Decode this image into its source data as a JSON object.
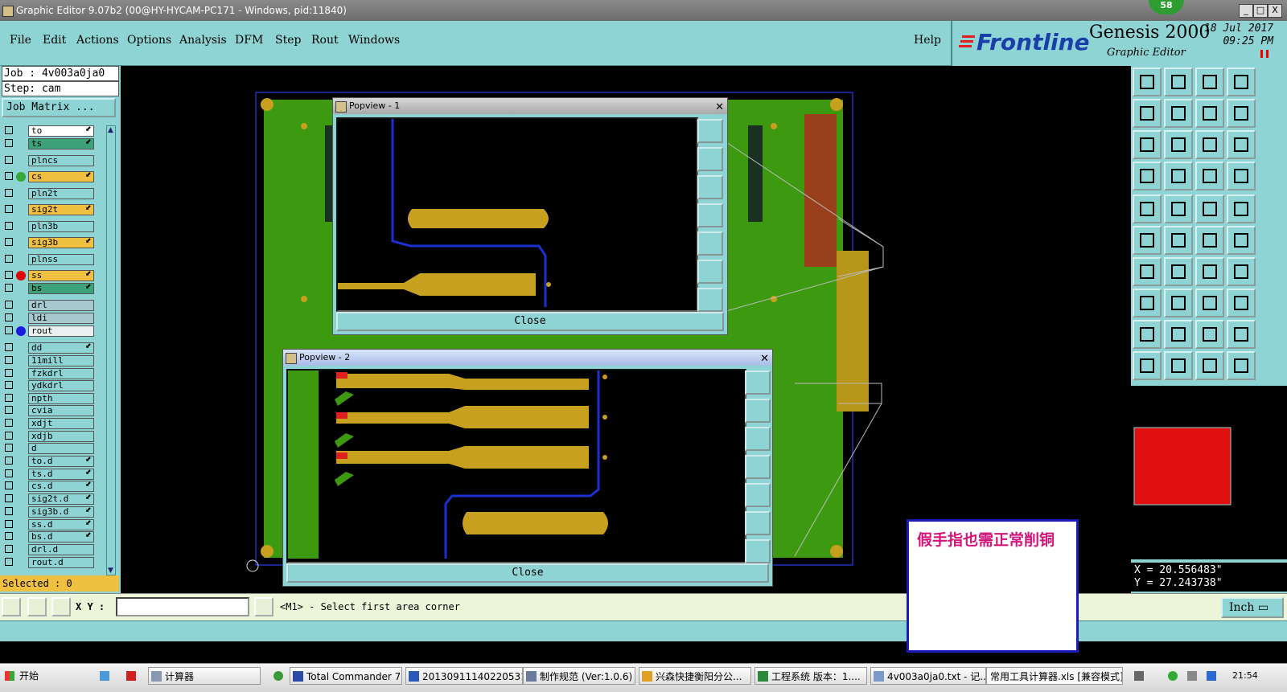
{
  "window": {
    "title": "Graphic Editor 9.07b2 (00@HY-HYCAM-PC171 - Windows, pid:11840)",
    "badge": "58",
    "min": "_",
    "max": "□",
    "close": "X"
  },
  "menu": {
    "items": [
      "File",
      "Edit",
      "Actions",
      "Options",
      "Analysis",
      "DFM",
      "Step",
      "Rout",
      "Windows"
    ],
    "help": "Help"
  },
  "brand": {
    "logo": "Frontline",
    "product": "Genesis 2000",
    "subtitle": "Graphic Editor",
    "date": "18 Jul 2017",
    "time": "09:25 PM"
  },
  "job": {
    "job_line": "Job : 4v003a0ja0",
    "step_line": "Step: cam",
    "matrix_button": "Job Matrix ...",
    "selected": "Selected : 0"
  },
  "layers": [
    {
      "name": "to",
      "color": "#ffffff",
      "dot": "",
      "arrow": "⬋"
    },
    {
      "name": "ts",
      "color": "#3da27a",
      "dot": "",
      "arrow": "⬋"
    },
    {
      "name": "plncs",
      "color": "#8fd4d4",
      "dot": "",
      "arrow": ""
    },
    {
      "name": "cs",
      "color": "#f0c040",
      "dot": "#38a838",
      "arrow": "⬋"
    },
    {
      "name": "pln2t",
      "color": "#8fd4d4",
      "dot": "",
      "arrow": ""
    },
    {
      "name": "sig2t",
      "color": "#f0c040",
      "dot": "",
      "arrow": "⬋"
    },
    {
      "name": "pln3b",
      "color": "#8fd4d4",
      "dot": "",
      "arrow": ""
    },
    {
      "name": "sig3b",
      "color": "#f0c040",
      "dot": "",
      "arrow": "⬋"
    },
    {
      "name": "plnss",
      "color": "#8fd4d4",
      "dot": "",
      "arrow": ""
    },
    {
      "name": "ss",
      "color": "#f0c040",
      "dot": "#e00000",
      "arrow": "⬋"
    },
    {
      "name": "bs",
      "color": "#3da27a",
      "dot": "",
      "arrow": "⬋"
    },
    {
      "name": "drl",
      "color": "#a8c8d0",
      "dot": "",
      "arrow": ""
    },
    {
      "name": "ldi",
      "color": "#a8c8d0",
      "dot": "",
      "arrow": ""
    },
    {
      "name": "rout",
      "color": "#e8f0f0",
      "dot": "#1a1ae0",
      "arrow": ""
    },
    {
      "name": "dd",
      "color": "#8fd4d4",
      "dot": "",
      "arrow": "⬋"
    },
    {
      "name": "11mill",
      "color": "#8fd4d4",
      "dot": "",
      "arrow": ""
    },
    {
      "name": "fzkdrl",
      "color": "#8fd4d4",
      "dot": "",
      "arrow": ""
    },
    {
      "name": "ydkdrl",
      "color": "#8fd4d4",
      "dot": "",
      "arrow": ""
    },
    {
      "name": "npth",
      "color": "#8fd4d4",
      "dot": "",
      "arrow": ""
    },
    {
      "name": "cvia",
      "color": "#8fd4d4",
      "dot": "",
      "arrow": ""
    },
    {
      "name": "xdjt",
      "color": "#8fd4d4",
      "dot": "",
      "arrow": ""
    },
    {
      "name": "xdjb",
      "color": "#8fd4d4",
      "dot": "",
      "arrow": ""
    },
    {
      "name": "d",
      "color": "#8fd4d4",
      "dot": "",
      "arrow": ""
    },
    {
      "name": "to.d",
      "color": "#8fd4d4",
      "dot": "",
      "arrow": "⬋"
    },
    {
      "name": "ts.d",
      "color": "#8fd4d4",
      "dot": "",
      "arrow": "⬋"
    },
    {
      "name": "cs.d",
      "color": "#8fd4d4",
      "dot": "",
      "arrow": "⬋"
    },
    {
      "name": "sig2t.d",
      "color": "#8fd4d4",
      "dot": "",
      "arrow": "⬋"
    },
    {
      "name": "sig3b.d",
      "color": "#8fd4d4",
      "dot": "",
      "arrow": "⬋"
    },
    {
      "name": "ss.d",
      "color": "#8fd4d4",
      "dot": "",
      "arrow": "⬋"
    },
    {
      "name": "bs.d",
      "color": "#8fd4d4",
      "dot": "",
      "arrow": "⬋"
    },
    {
      "name": "drl.d",
      "color": "#8fd4d4",
      "dot": "",
      "arrow": ""
    },
    {
      "name": "rout.d",
      "color": "#8fd4d4",
      "dot": "",
      "arrow": ""
    }
  ],
  "popup1": {
    "title": "Popview - 1",
    "close_label": "Close",
    "x": "✕"
  },
  "popup2": {
    "title": "Popview - 2",
    "close_label": "Close",
    "x": "✕"
  },
  "cmd": {
    "xy_label": "X Y :",
    "xy_value": "",
    "prompt": "<M1> - Select first area corner",
    "units": "Inch ▭"
  },
  "coords": {
    "x": "X = 20.556483\"",
    "y": "Y = 27.243738\""
  },
  "note": {
    "text": "假手指也需正常削铜"
  },
  "taskbar": {
    "start": "开始",
    "items": [
      "计算器",
      "Total Commander 7.0...",
      "20130911140220531...",
      "制作规范 (Ver:1.0.6)",
      "兴森快捷衡阳分公...",
      "工程系统  版本：1....",
      "4v003a0ja0.txt - 记...",
      "常用工具计算器.xls [兼容模式]"
    ],
    "clock": "21:54"
  }
}
